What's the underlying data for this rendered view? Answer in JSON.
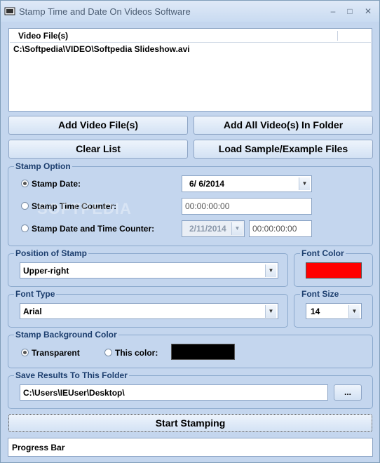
{
  "window": {
    "title": "Stamp Time and Date On Videos Software",
    "minimize": "–",
    "maximize": "□",
    "close": "✕"
  },
  "video_list": {
    "header": "Video File(s)",
    "items": [
      "C:\\Softpedia\\VIDEO\\Softpedia Slideshow.avi"
    ]
  },
  "buttons": {
    "add_files": "Add Video File(s)",
    "add_folder": "Add All Video(s) In Folder",
    "clear_list": "Clear List",
    "load_sample": "Load Sample/Example Files",
    "browse": "...",
    "start": "Start Stamping"
  },
  "stamp_option": {
    "label": "Stamp Option",
    "stamp_date_label": "Stamp Date:",
    "stamp_date_value": "6/  6/2014",
    "stamp_time_label": "Stamp Time Counter:",
    "stamp_time_value": "00:00:00:00",
    "stamp_date_time_label": "Stamp Date and Time Counter:",
    "date_time_date": "2/11/2014",
    "date_time_time": "00:00:00:00",
    "selected": "Stamp Date"
  },
  "position": {
    "label": "Position of Stamp",
    "value": "Upper-right"
  },
  "font_color": {
    "label": "Font Color",
    "color": "#ff0000"
  },
  "font_type": {
    "label": "Font Type",
    "value": "Arial"
  },
  "font_size": {
    "label": "Font Size",
    "value": "14"
  },
  "background": {
    "label": "Stamp Background Color",
    "transparent_label": "Transparent",
    "this_color_label": "This color:",
    "color": "#000000",
    "selected": "Transparent"
  },
  "save_folder": {
    "label": "Save Results To This Folder",
    "value": "C:\\Users\\IEUser\\Desktop\\"
  },
  "progress": {
    "label": "Progress Bar"
  },
  "watermark": "SOFTPEDIA",
  "icons": {
    "app": "video-stamp-icon",
    "dropdown": "chevron-down-icon"
  }
}
